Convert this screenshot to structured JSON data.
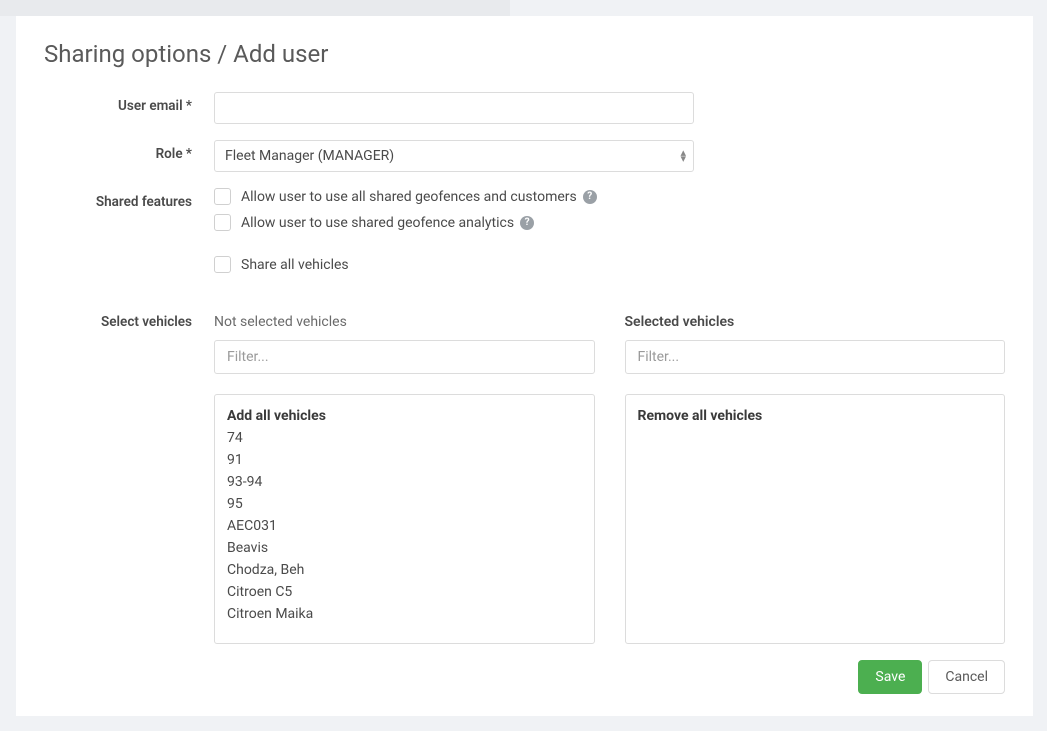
{
  "title": "Sharing options / Add user",
  "fields": {
    "email_label": "User email *",
    "email_value": "",
    "role_label": "Role *",
    "role_value": "Fleet Manager (MANAGER)",
    "shared_features_label": "Shared features",
    "checkbox_geofences": "Allow user to use all shared geofences and customers",
    "checkbox_analytics": "Allow user to use shared geofence analytics",
    "checkbox_share_all": "Share all vehicles",
    "select_vehicles_label": "Select vehicles"
  },
  "notSelected": {
    "header": "Not selected vehicles",
    "filter_placeholder": "Filter...",
    "action": "Add all vehicles",
    "items": [
      "74",
      "91",
      "93-94",
      "95",
      "AEC031",
      "Beavis",
      "Chodza, Beh",
      "Citroen C5",
      "Citroen Maika"
    ]
  },
  "selected": {
    "header": "Selected vehicles",
    "filter_placeholder": "Filter...",
    "action": "Remove all vehicles",
    "items": []
  },
  "buttons": {
    "save": "Save",
    "cancel": "Cancel"
  }
}
